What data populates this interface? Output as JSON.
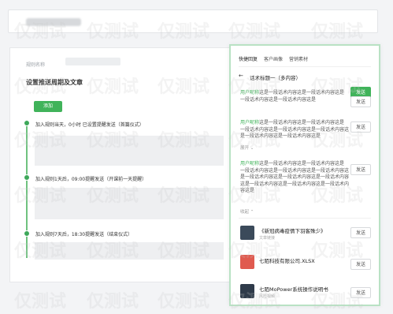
{
  "page": {
    "topbar": {
      "blurred_text": ""
    },
    "form": {
      "name_label": "规则名称",
      "heading": "设置推送周期及文章",
      "add_button": "添加"
    },
    "timeline": [
      {
        "text": "加入规则当天，0小时 已设置提醒发送（首篇仪式）"
      },
      {
        "text": "加入规则1天后，09:00提醒发送（开课前一天提醒）"
      },
      {
        "text": "加入规则7天后，18:30提醒发送（结束仪式）"
      }
    ]
  },
  "side": {
    "tabs": [
      "快捷回复",
      "客户画像",
      "营销素材"
    ],
    "back_arrow": "←",
    "title": "话术标题一（多内容）",
    "cards": [
      {
        "tag": "用户昵称",
        "text": "这是一段话术内容这是一段话术内容这是一段话术内容这是一段话术内容这是",
        "button": "发送"
      },
      {
        "tag": "用户昵称",
        "text": "这是一段话术内容这是一段话术内容这是一段话术内容这是一段话术内容这是一段话术内容这是一段话术内容这是一段话术内容这是",
        "fold": "展开 ⌄",
        "button": "发送"
      },
      {
        "tag": "用户昵称",
        "text": "这是一段话术内容这是一段话术内容这是一段话术内容这是一段话术内容这是一段话术内容这是一段话术内容这是一段话术内容这是一段话术内容这是一段话术内容这是一段话术内容这是一段话术内容这是",
        "fold": "收起 ⌃",
        "button": "发送"
      }
    ],
    "files": [
      {
        "title": "《新冠病毒疫情下羽客殊少》",
        "sub": "文章链接",
        "button": "发送",
        "color": "#3b4a5a"
      },
      {
        "title": "七陌科技有限公司.XLSX",
        "sub": "",
        "button": "发送",
        "color": "#e05a4f"
      },
      {
        "title": "七陌MoPower系统操作说明书",
        "sub": "风险视频",
        "button": "发送",
        "color": "#2f3b4a"
      }
    ]
  },
  "watermark": "仅测试"
}
